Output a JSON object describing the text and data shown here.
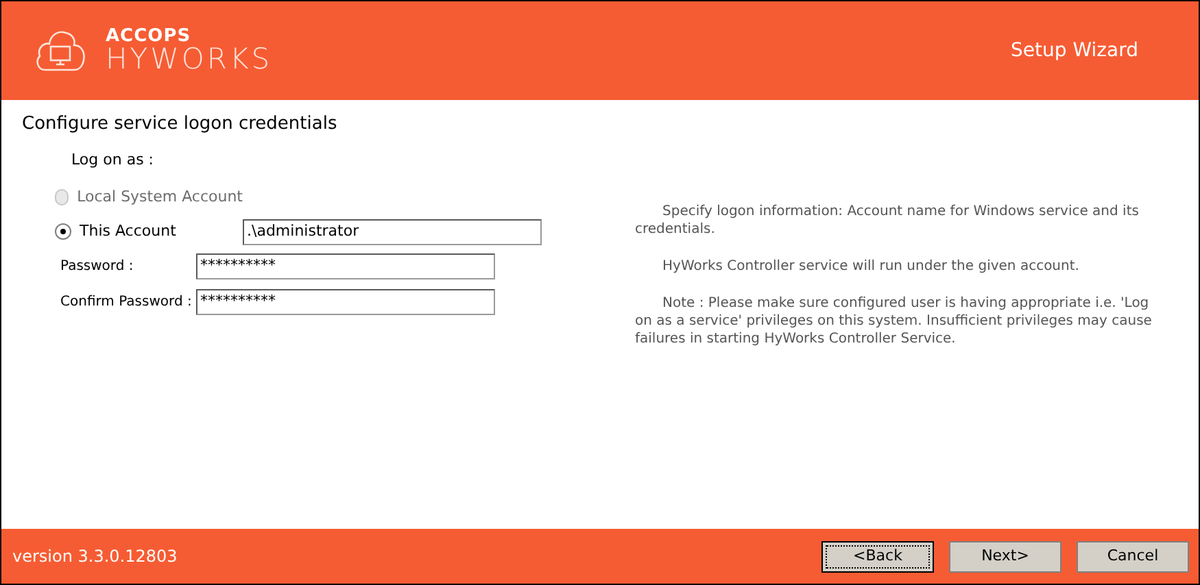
{
  "header": {
    "brand_top": "ACCOPS",
    "brand_bottom": "HYWORKS",
    "title": "Setup Wizard"
  },
  "page_title": "Configure service logon credentials",
  "logon_label": "Log on as :",
  "accounts": [
    {
      "label": "Local System Account",
      "selected": false,
      "disabled": true
    },
    {
      "label": "This Account",
      "selected": true,
      "disabled": false,
      "value": ".\\administrator"
    }
  ],
  "fields": [
    {
      "label": "Password :",
      "value": "**********"
    },
    {
      "label": "Confirm Password :",
      "value": "**********"
    }
  ],
  "help": [
    "Specify logon information: Account name for Windows service and its credentials.",
    "HyWorks Controller service will run under the given account.",
    "Note : Please make sure configured user is having appropriate i.e. 'Log on as a service' privileges on this system. Insufficient privileges may cause failures in starting HyWorks Controller Service."
  ],
  "version": "version 3.3.0.12803",
  "buttons": [
    {
      "label": "<Back",
      "focused": true
    },
    {
      "label": "Next>",
      "focused": false
    },
    {
      "label": "Cancel",
      "focused": false
    }
  ]
}
